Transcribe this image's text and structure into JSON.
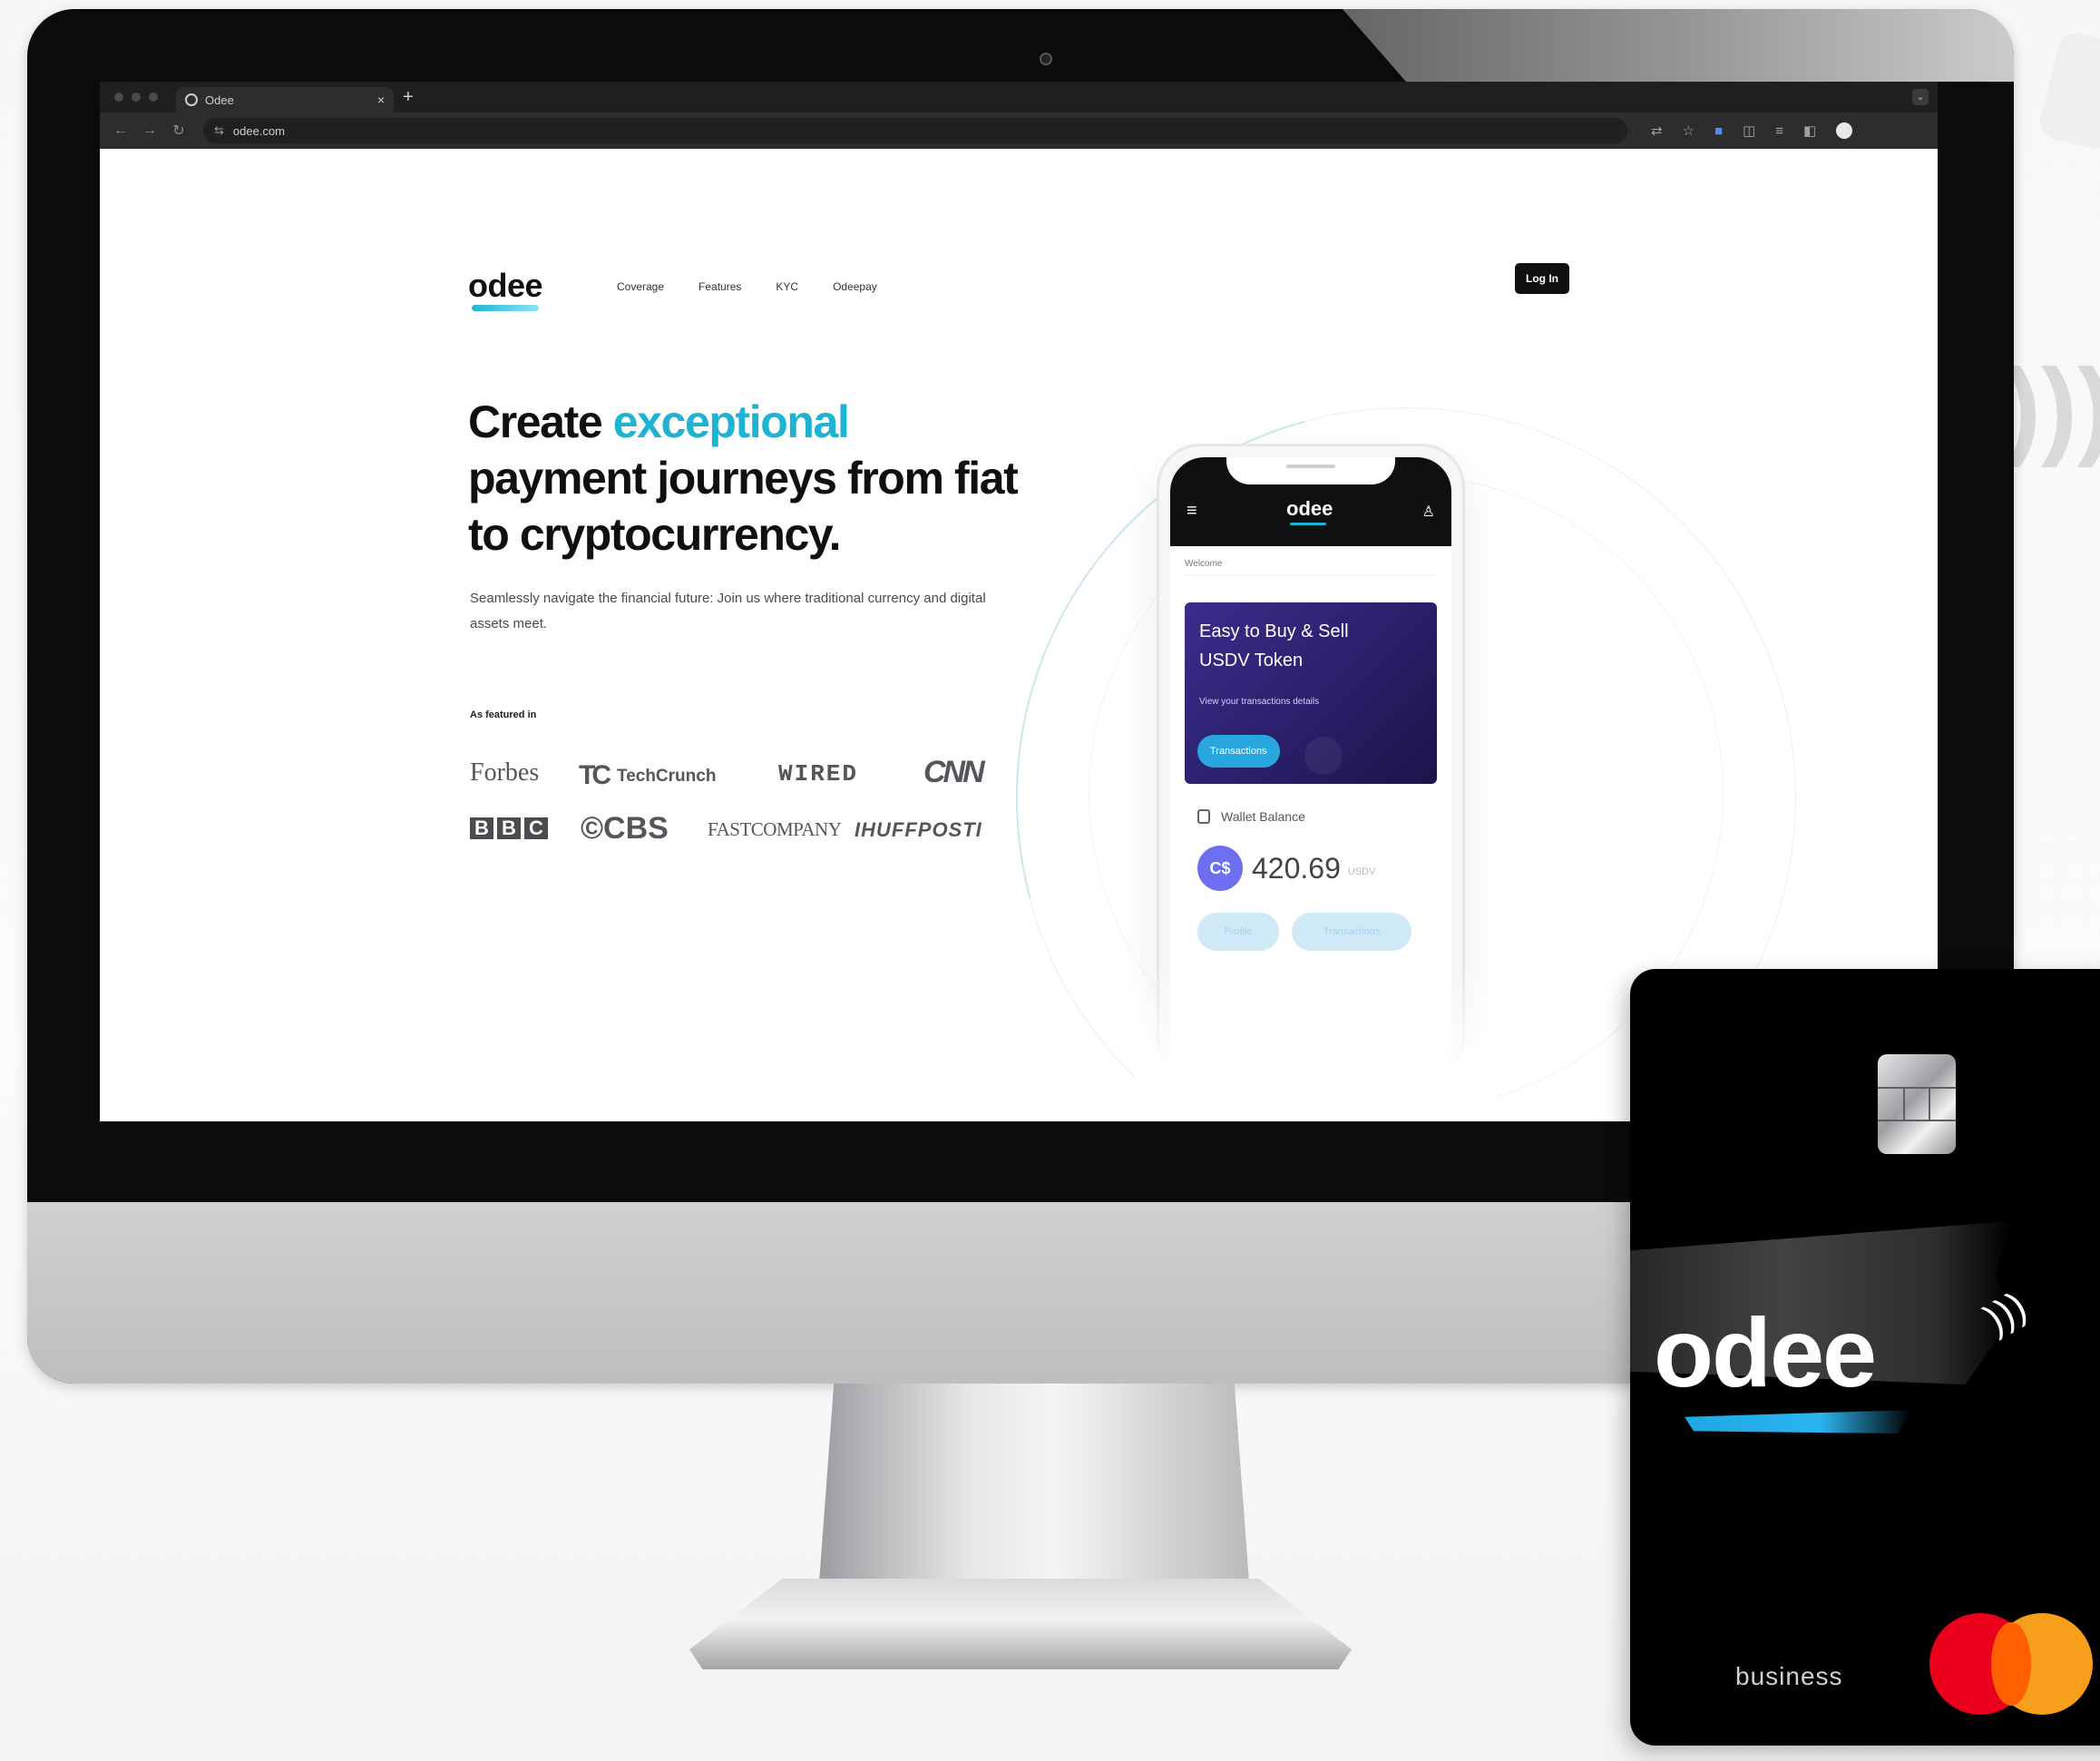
{
  "browser": {
    "tab_title": "Odee",
    "tab_close": "×",
    "new_tab": "+",
    "url": "odee.com"
  },
  "site": {
    "logo": "odee",
    "nav": [
      "Coverage",
      "Features",
      "KYC",
      "Odeepay"
    ],
    "login_label": "Log In",
    "hero": {
      "title_part1": "Create ",
      "title_accent": "exceptional",
      "title_part2": " payment journeys from fiat to cryptocurrency.",
      "subtitle": "Seamlessly navigate the financial future: Join us where traditional currency and digital assets meet."
    },
    "featured_label": "As featured in",
    "press": {
      "forbes": "Forbes",
      "techcrunch_mark": "TC",
      "techcrunch": "TechCrunch",
      "wired": "WIRED",
      "cnn": "CNN",
      "bbc": [
        "B",
        "B",
        "C"
      ],
      "cbs": "©CBS",
      "fastcompany": "FASTCOMPANY",
      "huffpost": "IHUFFPOSTI"
    }
  },
  "phone": {
    "logo": "odee",
    "welcome": "Welcome",
    "promo_title_line1": "Easy to Buy & Sell",
    "promo_title_line2": "USDV Token",
    "promo_sub": "View your transactions details",
    "promo_button": "Transactions",
    "wallet_label": "Wallet Balance",
    "coin_symbol": "C$",
    "balance": "420.69",
    "balance_unit": "USDV",
    "btn_profile": "Profile",
    "btn_transactions": "Transactions"
  },
  "card": {
    "logo": "odee",
    "tier": "business",
    "network": "mastercard"
  },
  "colors": {
    "accent": "#1fb3d3",
    "promo_purple": "#2a1f6a",
    "promo_button": "#28a7df",
    "coin": "#6d6ff0",
    "mastercard_red": "#eb001b",
    "mastercard_yellow": "#f79e1b"
  }
}
